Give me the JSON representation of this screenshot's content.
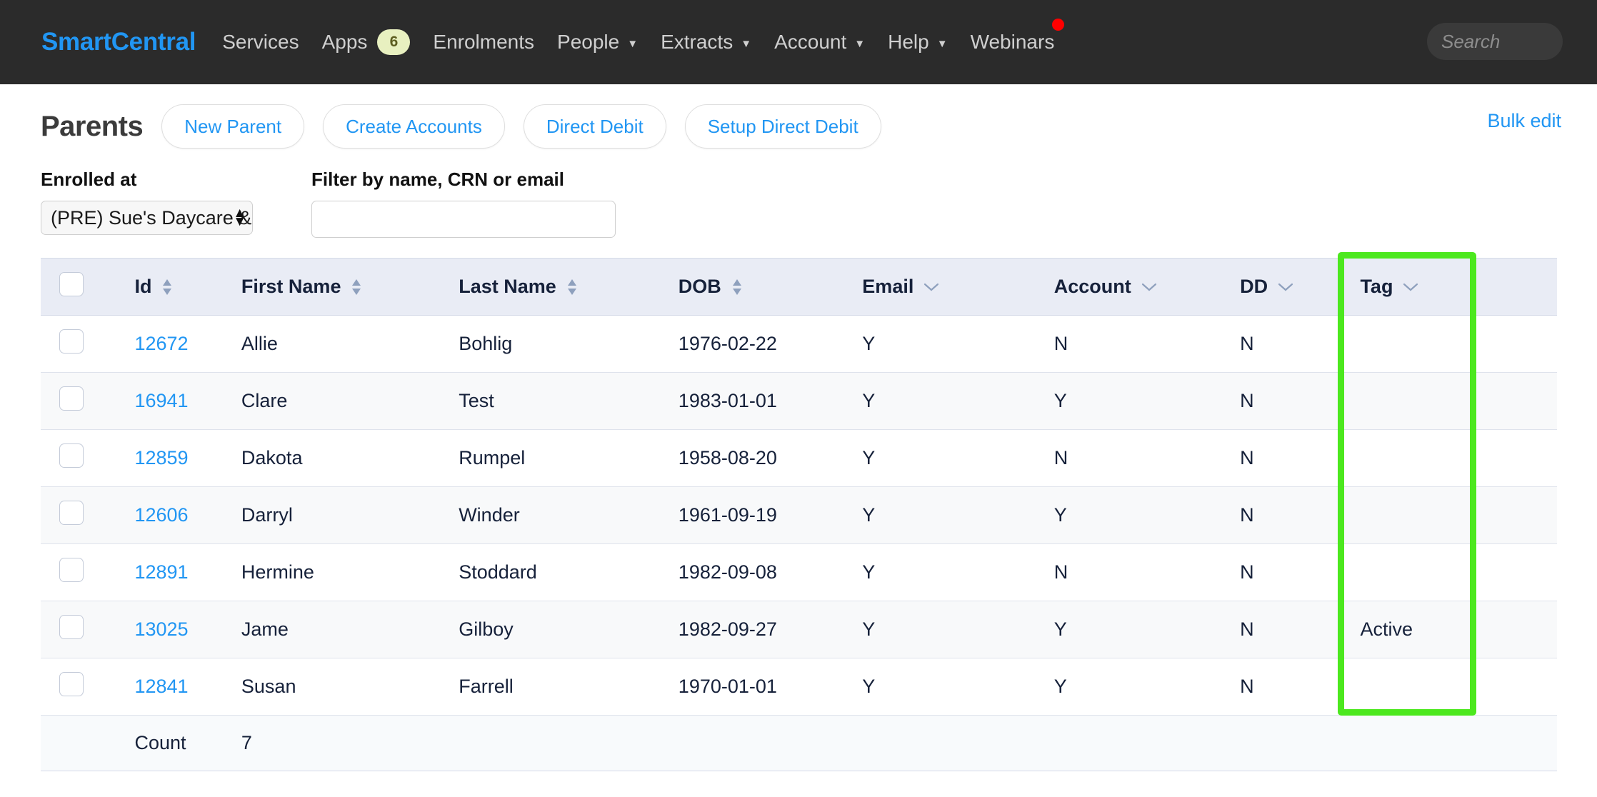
{
  "navbar": {
    "brand": "SmartCentral",
    "items": [
      {
        "label": "Services",
        "caret": false
      },
      {
        "label": "Apps",
        "caret": false,
        "badge": "6"
      },
      {
        "label": "Enrolments",
        "caret": false
      },
      {
        "label": "People",
        "caret": true
      },
      {
        "label": "Extracts",
        "caret": true
      },
      {
        "label": "Account",
        "caret": true
      },
      {
        "label": "Help",
        "caret": true
      },
      {
        "label": "Webinars",
        "caret": false,
        "notification_dot": true
      }
    ],
    "caret_glyph": "▼",
    "search": {
      "placeholder": "Search",
      "value": "",
      "icon": "search-icon"
    },
    "colors": {
      "background": "#2b2b2b",
      "brand": "#2196f3",
      "badge_bg": "#e8f0c0",
      "dot": "#ff0000"
    }
  },
  "page": {
    "title": "Parents",
    "buttons": [
      {
        "label": "New Parent"
      },
      {
        "label": "Create Accounts"
      },
      {
        "label": "Direct Debit"
      },
      {
        "label": "Setup Direct Debit"
      }
    ],
    "bulk_edit_label": "Bulk edit",
    "link_color": "#2196f3"
  },
  "filters": {
    "enrolled_at": {
      "label": "Enrolled at",
      "selected": "(PRE) Sue's Daycare & Kir",
      "up_arrow": "▲",
      "down_arrow": "▼"
    },
    "name_filter": {
      "label": "Filter by name, CRN or email",
      "value": "",
      "placeholder": ""
    }
  },
  "table": {
    "columns": [
      {
        "key": "check",
        "label": "",
        "icon": ""
      },
      {
        "key": "id",
        "label": "Id",
        "icon": "sort-arrows-icon"
      },
      {
        "key": "first",
        "label": "First Name",
        "icon": "sort-arrows-icon"
      },
      {
        "key": "last",
        "label": "Last Name",
        "icon": "sort-arrows-icon"
      },
      {
        "key": "dob",
        "label": "DOB",
        "icon": "sort-arrows-icon"
      },
      {
        "key": "email",
        "label": "Email",
        "icon": "chevron-down-icon"
      },
      {
        "key": "acct",
        "label": "Account",
        "icon": "chevron-down-icon"
      },
      {
        "key": "dd",
        "label": "DD",
        "icon": "chevron-down-icon"
      },
      {
        "key": "tag",
        "label": "Tag",
        "icon": "chevron-down-icon"
      },
      {
        "key": "end",
        "label": "",
        "icon": ""
      }
    ],
    "rows": [
      {
        "id": "12672",
        "first": "Allie",
        "last": "Bohlig",
        "dob": "1976-02-22",
        "email": "Y",
        "account": "N",
        "dd": "N",
        "tag": ""
      },
      {
        "id": "16941",
        "first": "Clare",
        "last": "Test",
        "dob": "1983-01-01",
        "email": "Y",
        "account": "Y",
        "dd": "N",
        "tag": ""
      },
      {
        "id": "12859",
        "first": "Dakota",
        "last": "Rumpel",
        "dob": "1958-08-20",
        "email": "Y",
        "account": "N",
        "dd": "N",
        "tag": ""
      },
      {
        "id": "12606",
        "first": "Darryl",
        "last": "Winder",
        "dob": "1961-09-19",
        "email": "Y",
        "account": "Y",
        "dd": "N",
        "tag": ""
      },
      {
        "id": "12891",
        "first": "Hermine",
        "last": "Stoddard",
        "dob": "1982-09-08",
        "email": "Y",
        "account": "N",
        "dd": "N",
        "tag": ""
      },
      {
        "id": "13025",
        "first": "Jame",
        "last": "Gilboy",
        "dob": "1982-09-27",
        "email": "Y",
        "account": "Y",
        "dd": "N",
        "tag": "Active"
      },
      {
        "id": "12841",
        "first": "Susan",
        "last": "Farrell",
        "dob": "1970-01-01",
        "email": "Y",
        "account": "Y",
        "dd": "N",
        "tag": ""
      }
    ],
    "footer": {
      "label": "Count",
      "value": "7"
    }
  },
  "annotation": {
    "highlight_color": "#4ce81e",
    "highlighted_column": "Tag"
  }
}
